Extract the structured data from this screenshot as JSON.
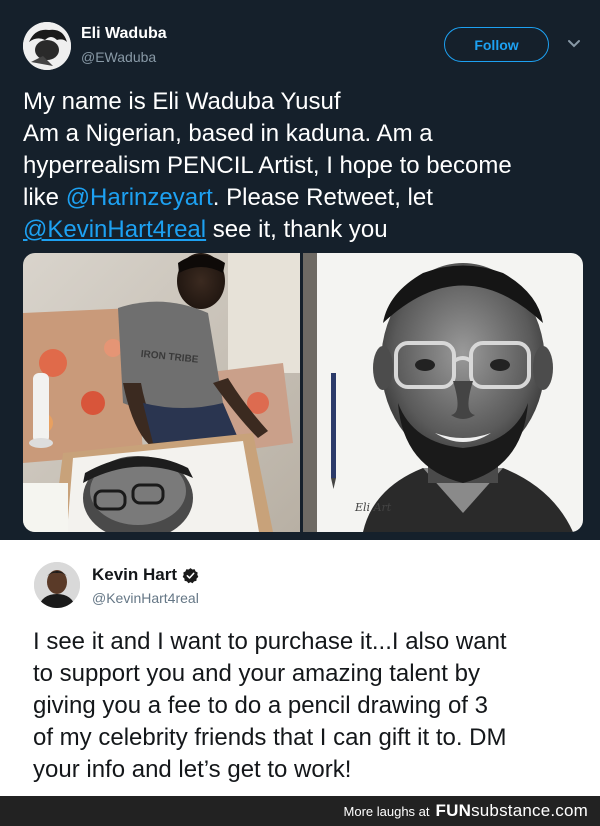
{
  "tweet": {
    "author_name": "Eli Waduba",
    "author_handle": "@EWaduba",
    "follow_label": "Follow",
    "text_lines": {
      "l1": "My name is Eli Waduba Yusuf",
      "l2": "Am a Nigerian, based in kaduna. Am a",
      "l3": "hyperrealism PENCIL Artist, I hope to become",
      "l4_pre": "like ",
      "l4_mention": "@Harinzeyart",
      "l4_post": ". Please Retweet, let",
      "l5_mention": "@KevinHart4real",
      "l5_post": " see it, thank you"
    },
    "photos": [
      "artist-drawing-photo",
      "finished-portrait-photo"
    ],
    "photo_signature": "Eli Art"
  },
  "reply": {
    "author_name": "Kevin Hart",
    "author_handle": "@KevinHart4real",
    "verified": true,
    "text_lines": {
      "l1": "I see it and I want to purchase it...I also want",
      "l2": "to support you and your amazing talent by",
      "l3": "giving you a fee to do a pencil drawing of 3",
      "l4": "of my celebrity friends that I can gift it to. DM",
      "l5": "your info and let’s get to work!"
    }
  },
  "footer": {
    "tagline": "More laughs at",
    "brand_bold": "FUN",
    "brand_light": "substance",
    "brand_suffix": ".com"
  },
  "colors": {
    "background": "#15202b",
    "accent": "#1da1f2",
    "muted": "#8899a6",
    "reply_bg": "#ffffff",
    "footer_bg": "#222222"
  }
}
